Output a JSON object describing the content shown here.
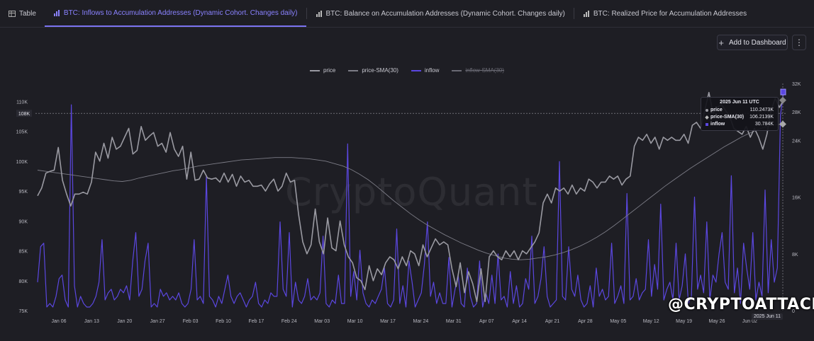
{
  "tabs": [
    {
      "label": "Table",
      "active": false
    },
    {
      "label": "BTC: Inflows to Accumulation Addresses (Dynamic Cohort. Changes daily)",
      "active": true
    },
    {
      "label": "BTC: Balance on Accumulation Addresses (Dynamic Cohort. Changes daily)",
      "active": false
    },
    {
      "label": "BTC: Realized Price for Accumulation Addresses",
      "active": false
    }
  ],
  "toolbar": {
    "add_dashboard_label": "Add to Dashboard",
    "more_label": "⋮"
  },
  "brand_watermark": "CryptoQuant",
  "credit_watermark": "@CRYPTOATTACK",
  "colors": {
    "price": "#9a9aa2",
    "sma": "#7c7c86",
    "inflow": "#5b47e0",
    "inflow_sma": "#6a6a74",
    "bg": "#1e1e24"
  },
  "tooltip": {
    "title": "2025 Jun 11 UTC",
    "rows": [
      {
        "label": "price",
        "value": "110.2473K"
      },
      {
        "label": "price-SMA(30)",
        "value": "106.2139K"
      },
      {
        "label": "inflow",
        "value": "30.784K"
      }
    ]
  },
  "crosshair_price_label": "108K",
  "crosshair_date_label": "2025 Jun 11",
  "chart_data": {
    "type": "line",
    "legend": [
      "price",
      "price-SMA(30)",
      "inflow",
      "inflow-SMA(30)"
    ],
    "legend_placement": "top-center",
    "x_ticks": [
      "Jan 06",
      "Jan 13",
      "Jan 20",
      "Jan 27",
      "Feb 03",
      "Feb 10",
      "Feb 17",
      "Feb 24",
      "Mar 03",
      "Mar 10",
      "Mar 17",
      "Mar 24",
      "Mar 31",
      "Apr 07",
      "Apr 14",
      "Apr 21",
      "Apr 28",
      "May 05",
      "May 12",
      "May 19",
      "May 26",
      "Jun 02"
    ],
    "y_left_ticks": [
      "110K",
      "105K",
      "100K",
      "95K",
      "90K",
      "85K",
      "80K",
      "75K"
    ],
    "y_left_range": [
      75,
      113
    ],
    "y_right_ticks": [
      "32K",
      "28K",
      "24K",
      "16K",
      "8K",
      "0"
    ],
    "y_right_range": [
      0,
      32
    ],
    "series": [
      {
        "name": "price",
        "unit": "K USD",
        "values": [
          94.2,
          95.5,
          98.0,
          98.3,
          98.5,
          102.3,
          96.8,
          94.5,
          92.5,
          94.5,
          94.5,
          94.8,
          94.5,
          96.5,
          101.5,
          100.0,
          103.0,
          100.5,
          104.0,
          102.0,
          102.5,
          104.0,
          105.5,
          101.2,
          101.8,
          105.8,
          103.5,
          104.2,
          104.8,
          102.5,
          103.0,
          101.5,
          104.8,
          102.0,
          100.8,
          102.5,
          97.0,
          101.5,
          96.8,
          97.0,
          98.5,
          97.2,
          97.0,
          97.2,
          96.5,
          98.0,
          96.5,
          97.8,
          95.8,
          97.5,
          96.5,
          96.8,
          95.8,
          95.8,
          96.0,
          95.0,
          96.2,
          97.0,
          95.0,
          95.8,
          98.0,
          96.5,
          96.8,
          91.0,
          86.5,
          84.5,
          86.0,
          92.0,
          86.5,
          84.5,
          90.5,
          85.5,
          85.0,
          90.0,
          86.0,
          84.0,
          83.0,
          80.5,
          80.0,
          78.5,
          82.5,
          80.0,
          82.0,
          81.0,
          83.0,
          84.0,
          83.5,
          82.0,
          84.0,
          82.5,
          85.0,
          84.5,
          82.5,
          86.0,
          84.0,
          85.5,
          87.0,
          86.0,
          86.5,
          86.0,
          82.0,
          79.0,
          83.0,
          78.0,
          81.5,
          79.5,
          76.5,
          82.0,
          76.5,
          84.0,
          85.0,
          84.0,
          83.5,
          85.0,
          84.0,
          85.0,
          83.5,
          85.0,
          84.5,
          85.5,
          86.5,
          88.0,
          93.0,
          94.5,
          93.0,
          95.5,
          95.0,
          95.5,
          94.5,
          96.0,
          94.5,
          95.5,
          95.0,
          97.0,
          96.5,
          95.5,
          96.5,
          96.5,
          97.5,
          97.0,
          97.5,
          96.0,
          97.0,
          97.5,
          102.5,
          104.0,
          103.5,
          104.5,
          103.0,
          104.0,
          102.0,
          104.0,
          103.5,
          104.0,
          103.5,
          103.5,
          104.5,
          103.0,
          106.0,
          106.5,
          105.5,
          108.5,
          111.5,
          108.0,
          109.0,
          109.5,
          108.5,
          107.5,
          105.5,
          105.0,
          104.5,
          105.8,
          104.0,
          105.5,
          104.0,
          102.0,
          104.5,
          108.5,
          110.5,
          109.0,
          110.2
        ]
      },
      {
        "name": "price-SMA(30)",
        "unit": "K USD",
        "values": [
          98.5,
          98.3,
          98.1,
          97.9,
          97.7,
          97.5,
          97.3,
          97.1,
          96.9,
          96.7,
          96.6,
          96.8,
          97.2,
          97.5,
          97.8,
          98.1,
          98.4,
          98.6,
          98.9,
          99.2,
          99.4,
          99.6,
          99.8,
          100.0,
          100.2,
          100.3,
          100.4,
          100.5,
          100.6,
          100.6,
          100.6,
          100.5,
          100.4,
          100.2,
          100.0,
          99.6,
          99.2,
          98.6,
          97.8,
          96.9,
          95.8,
          94.6,
          93.4,
          92.3,
          91.2,
          90.2,
          89.3,
          88.5,
          87.7,
          87.0,
          86.3,
          85.7,
          85.1,
          84.6,
          84.2,
          83.8,
          83.6,
          83.5,
          83.6,
          83.8,
          84.0,
          84.3,
          84.7,
          85.2,
          85.8,
          86.5,
          87.3,
          88.2,
          89.2,
          90.3,
          91.4,
          92.5,
          93.6,
          94.7,
          95.8,
          96.8,
          97.8,
          98.8,
          99.7,
          100.6,
          101.5,
          102.4,
          103.2,
          104.0,
          104.7,
          105.3,
          105.8,
          106.1,
          106.2
        ]
      },
      {
        "name": "inflow",
        "unit": "K BTC",
        "values": [
          4.0,
          9.0,
          9.5,
          0.5,
          1.0,
          0.5,
          2.0,
          4.5,
          5.0,
          1.5,
          0.5,
          29.0,
          3.5,
          0.5,
          2.0,
          1.0,
          0.5,
          0.5,
          1.0,
          2.0,
          4.0,
          10.0,
          1.5,
          2.5,
          3.0,
          1.5,
          2.0,
          3.0,
          2.5,
          3.5,
          1.5,
          7.0,
          11.0,
          2.0,
          3.0,
          7.0,
          9.5,
          0.5,
          1.0,
          0.5,
          3.0,
          2.0,
          2.5,
          1.5,
          2.0,
          1.5,
          2.5,
          1.0,
          0.5,
          1.0,
          3.0,
          10.0,
          1.5,
          2.0,
          1.0,
          19.0,
          2.0,
          1.5,
          0.5,
          2.0,
          1.0,
          3.0,
          5.0,
          2.0,
          1.0,
          2.0,
          2.5,
          1.5,
          0.5,
          1.5,
          2.0,
          4.0,
          1.0,
          0.5,
          1.5,
          1.0,
          2.5,
          2.0,
          2.0,
          12.5,
          3.0,
          2.0,
          11.0,
          0.5,
          4.0,
          1.5,
          1.0,
          2.0,
          4.5,
          1.5,
          2.0,
          1.5,
          2.5,
          10.5,
          1.0,
          0.5,
          1.5,
          1.0,
          5.0,
          1.0,
          1.0,
          23.5,
          2.0,
          5.5,
          1.5,
          8.5,
          2.5,
          1.0,
          0.5,
          1.5,
          1.0,
          2.0,
          3.0,
          6.0,
          1.0,
          0.5,
          1.5,
          11.5,
          1.0,
          3.5,
          0.5,
          7.0,
          4.0,
          0.5,
          1.5,
          2.5,
          6.5,
          12.5,
          2.0,
          4.0,
          1.0,
          2.5,
          1.0,
          1.0,
          7.5,
          0.5,
          3.0,
          5.0,
          1.0,
          0.5,
          6.0,
          2.0,
          0.5,
          1.0,
          7.0,
          0.5,
          2.5,
          1.0,
          5.0,
          1.0,
          8.0,
          1.5,
          2.0,
          0.5,
          5.5,
          1.0,
          3.5,
          0.5,
          1.0,
          4.5,
          3.0,
          10.5,
          1.0,
          2.0,
          4.5,
          9.0,
          2.0,
          0.5,
          1.0,
          1.5,
          21.0,
          2.0,
          1.5,
          9.0,
          3.0,
          2.0,
          5.0,
          1.5,
          0.5,
          1.0,
          3.5,
          0.5,
          6.0,
          2.0,
          3.0,
          1.5,
          2.0,
          9.5,
          1.0,
          2.0,
          3.5,
          1.0,
          16.5,
          1.5,
          2.0,
          4.5,
          1.5,
          2.5,
          3.0,
          10.0,
          2.0,
          6.5,
          3.0,
          15.0,
          1.5,
          3.0,
          4.0,
          1.5,
          9.5,
          1.5,
          3.5,
          8.0,
          1.0,
          2.0,
          16.0,
          3.0,
          5.0,
          2.5,
          12.5,
          1.5,
          5.0,
          4.0,
          8.0,
          11.0,
          4.0,
          3.0,
          19.0,
          2.5,
          6.0,
          1.0,
          9.5,
          6.0,
          3.0,
          11.0,
          1.5,
          4.0,
          2.0,
          17.0,
          2.5,
          10.0,
          4.0,
          6.0,
          27.5,
          30.8
        ]
      }
    ]
  }
}
